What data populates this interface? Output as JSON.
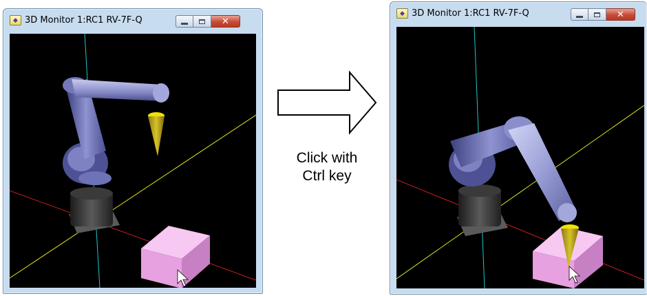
{
  "before_window": {
    "title": "3D Monitor 1:RC1 RV-7F-Q",
    "icon": "3d-monitor-icon",
    "controls": [
      "minimize-icon",
      "maximize-icon",
      "close-icon"
    ]
  },
  "after_window": {
    "title": "3D Monitor 1:RC1 RV-7F-Q",
    "icon": "3d-monitor-icon",
    "controls": [
      "minimize-icon",
      "maximize-icon",
      "close-icon"
    ]
  },
  "transition": {
    "icon": "right-arrow-icon",
    "caption_line1": "Click with",
    "caption_line2": "Ctrl key"
  },
  "colors": {
    "viewport_bg": "#000000",
    "robot": "#6f73b0",
    "workpiece": "#f0a8e8",
    "tool": "#d8c22a",
    "axis_x": "#c81e1e",
    "axis_y": "#e6e61e",
    "axis_z": "#1ec8c8"
  }
}
